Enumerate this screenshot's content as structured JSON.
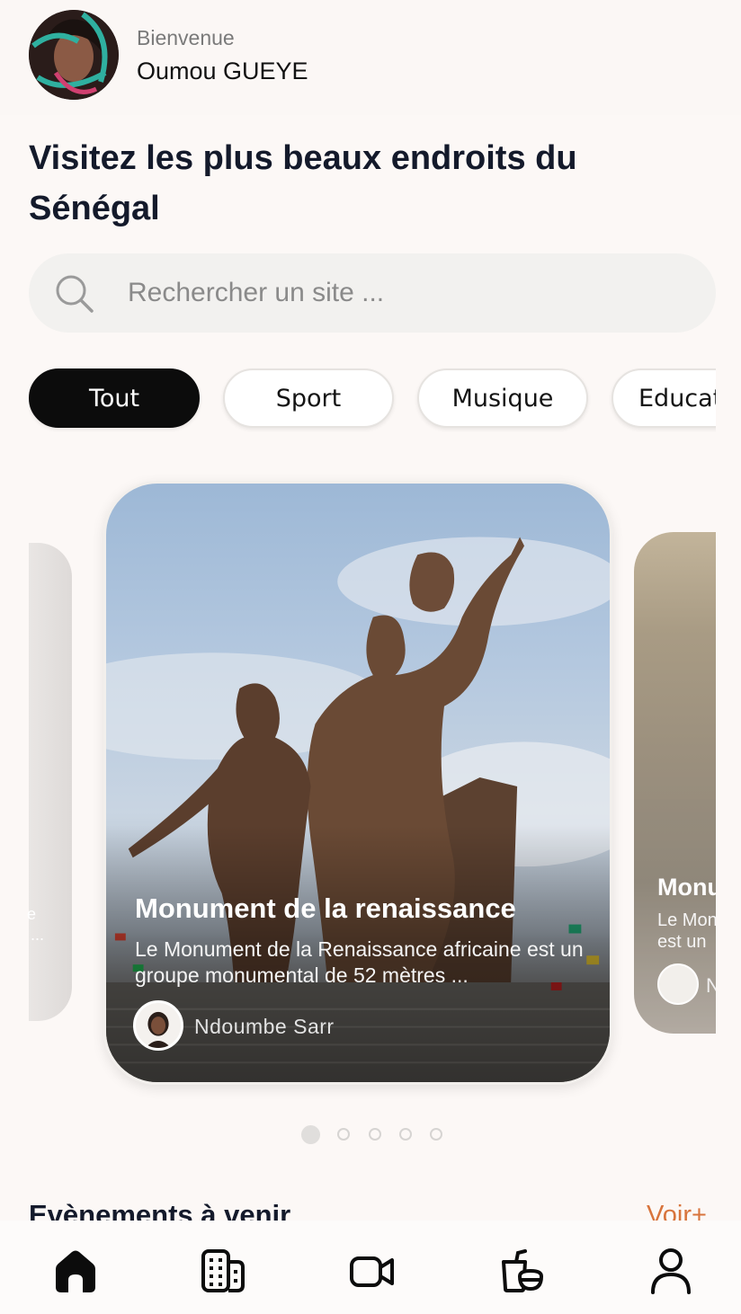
{
  "header": {
    "welcome": "Bienvenue",
    "username": "Oumou GUEYE"
  },
  "page": {
    "title": "Visitez les plus beaux endroits du Sénégal"
  },
  "search": {
    "placeholder": "Rechercher un site ..."
  },
  "categories": [
    {
      "label": "Tout",
      "active": true
    },
    {
      "label": "Sport",
      "active": false
    },
    {
      "label": "Musique",
      "active": false
    },
    {
      "label": "Education",
      "active": false
    }
  ],
  "carousel": {
    "left_fragment": {
      "line1": "e",
      "line2": "..."
    },
    "current": {
      "title": "Monument de la renaissance",
      "description": "Le Monument de la Renaissance africaine est un groupe monumental de 52 mètres ...",
      "author": "Ndoumbe Sarr"
    },
    "next": {
      "title": "Monu",
      "description_line1": "Le Mon",
      "description_line2": "est un",
      "author": "N"
    },
    "page_count": 5,
    "active_index": 0
  },
  "events": {
    "title": "Evènements à venir",
    "see_more": "Voir+"
  },
  "bottom_nav": [
    {
      "icon": "home-icon",
      "active": true
    },
    {
      "icon": "buildings-icon",
      "active": false
    },
    {
      "icon": "video-camera-icon",
      "active": false
    },
    {
      "icon": "food-bowl-icon",
      "active": false
    },
    {
      "icon": "profile-icon",
      "active": false
    }
  ],
  "colors": {
    "background": "#fcf8f6",
    "accent": "#d8743c",
    "chip_active": "#0c0c0c",
    "text_primary": "#141a2b"
  }
}
